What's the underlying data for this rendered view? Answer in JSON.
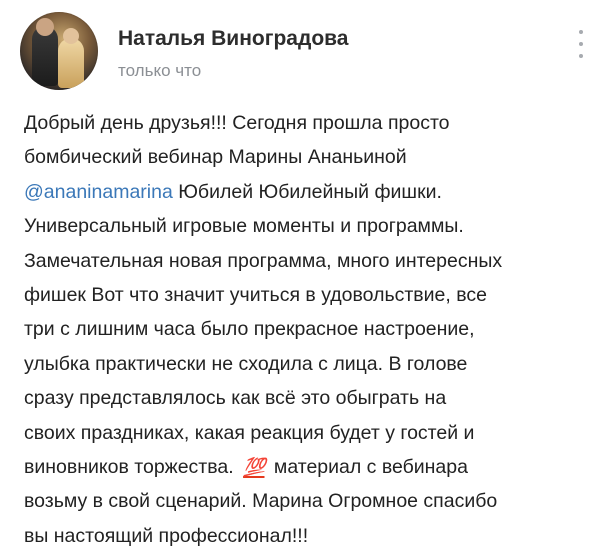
{
  "post": {
    "author_name": "Наталья Виноградова",
    "time": "только что",
    "avatar_icon": "user-avatar-photo",
    "more_icon": "vertical-dots-icon",
    "colors": {
      "link": "#3b78b8",
      "secondary_text": "#8b8f94",
      "emoji": "#e5391d"
    },
    "text_lines": {
      "l1": "Добрый день друзья!!! Сегодня прошла просто",
      "l2": "бомбический вебинар  Марины Ананьиной",
      "l3_mention": "@ananinamarina",
      "l3_rest": " Юбилей Юбилейный фишки.",
      "l4": "Универсальный игровые моменты и программы.",
      "l5": "Замечательная новая программа, много интересных",
      "l6": "фишек Вот что значит учиться в удовольствие, все",
      "l7": "три с лишним часа было прекрасное настроение,",
      "l8": "улыбка практически не сходила с лица. В голове",
      "l9": "сразу представлялось как всё это обыграть на",
      "l10": "своих праздниках,  какая реакция будет у гостей  и",
      "l11_before": "виновников торжества.",
      "l11_emoji": "💯",
      "l11_after": "материал с вебинара",
      "l12": "возьму в свой сценарий. Марина Огромное спасибо",
      "l13": "вы настоящий профессионал!!!"
    }
  }
}
